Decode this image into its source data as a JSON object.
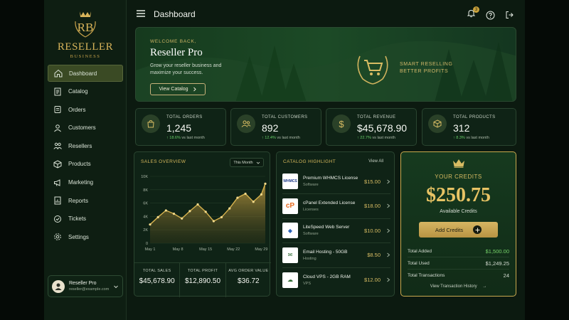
{
  "brand": {
    "initials": "RB",
    "name": "RESELLER",
    "sub": "BUSINESS"
  },
  "header": {
    "title": "Dashboard",
    "notification_count": "3"
  },
  "sidebar": {
    "items": [
      {
        "label": "Dashboard",
        "icon": "dashboard-icon",
        "active": true
      },
      {
        "label": "Catalog",
        "icon": "catalog-icon"
      },
      {
        "label": "Orders",
        "icon": "orders-icon"
      },
      {
        "label": "Customers",
        "icon": "customers-icon"
      },
      {
        "label": "Resellers",
        "icon": "resellers-icon"
      },
      {
        "label": "Products",
        "icon": "products-icon"
      },
      {
        "label": "Marketing",
        "icon": "marketing-icon"
      },
      {
        "label": "Reports",
        "icon": "reports-icon"
      },
      {
        "label": "Tickets",
        "icon": "tickets-icon"
      },
      {
        "label": "Settings",
        "icon": "settings-icon"
      }
    ],
    "user": {
      "name": "Reseller Pro",
      "email": "reseller@example.com"
    }
  },
  "hero": {
    "welcome": "WELCOME BACK,",
    "name": "Reseller Pro",
    "desc": "Grow your reseller business and maximize your success.",
    "cta": "View Catalog",
    "tagline1": "SMART RESELLING",
    "tagline2": "BETTER PROFITS"
  },
  "stats": [
    {
      "label": "TOTAL ORDERS",
      "value": "1,245",
      "trend": "18.6%",
      "trend_text": "vs last month",
      "icon": "bag-icon"
    },
    {
      "label": "TOTAL CUSTOMERS",
      "value": "892",
      "trend": "12.4%",
      "trend_text": "vs last month",
      "icon": "users-icon"
    },
    {
      "label": "TOTAL REVENUE",
      "value": "$45,678.90",
      "trend": "22.7%",
      "trend_text": "vs last month",
      "icon": "dollar-icon"
    },
    {
      "label": "TOTAL PRODUCTS",
      "value": "312",
      "trend": "8.3%",
      "trend_text": "vs last month",
      "icon": "box-icon"
    }
  ],
  "sales": {
    "title": "SALES OVERVIEW",
    "period": "This Month",
    "summary": [
      {
        "label": "TOTAL SALES",
        "value": "$45,678.90"
      },
      {
        "label": "TOTAL PROFIT",
        "value": "$12,890.50"
      },
      {
        "label": "AVG ORDER VALUE",
        "value": "$36.72"
      }
    ]
  },
  "chart_data": {
    "type": "area",
    "x": [
      1,
      3,
      5,
      7,
      9,
      11,
      13,
      15,
      17,
      19,
      21,
      23,
      25,
      27,
      29,
      30
    ],
    "values": [
      2800,
      3900,
      4900,
      4400,
      3700,
      4800,
      5800,
      4700,
      3300,
      3900,
      5200,
      6800,
      7400,
      6200,
      7300,
      8900
    ],
    "xticks": [
      "May 1",
      "May 8",
      "May 15",
      "May 22",
      "May 29"
    ],
    "xtick_positions": [
      1,
      8,
      15,
      22,
      29
    ],
    "yticks": [
      "0",
      "2K",
      "4K",
      "6K",
      "8K",
      "10K"
    ],
    "ylim": [
      0,
      10000
    ],
    "xlim": [
      1,
      30
    ],
    "grid": true,
    "color": "#d6b24e"
  },
  "catalog": {
    "title": "CATALOG HIGHLIGHT",
    "view_all": "View All",
    "items": [
      {
        "name": "Premium WHMCS License",
        "category": "Software",
        "price": "$15.00",
        "logo": "WHMCS",
        "icon": "whmcs-icon"
      },
      {
        "name": "cPanel Extended License",
        "category": "Licenses",
        "price": "$18.00",
        "logo": "cP",
        "icon": "cpanel-icon"
      },
      {
        "name": "LiteSpeed Web Server",
        "category": "Software",
        "price": "$10.00",
        "logo": "",
        "icon": "litespeed-icon"
      },
      {
        "name": "Email Hosting - 50GB",
        "category": "Hosting",
        "price": "$8.50",
        "logo": "",
        "icon": "email-icon"
      },
      {
        "name": "Cloud VPS - 2GB RAM",
        "category": "VPS",
        "price": "$12.00",
        "logo": "",
        "icon": "cloud-icon"
      }
    ]
  },
  "credits": {
    "title": "YOUR CREDITS",
    "amount": "$250.75",
    "available": "Available Credits",
    "add_label": "Add Credits",
    "rows": [
      {
        "label": "Total Added",
        "value": "$1,500.00"
      },
      {
        "label": "Total Used",
        "value": "$1,249.25"
      },
      {
        "label": "Total Transactions",
        "value": "24"
      }
    ],
    "history": "View Transaction History"
  },
  "colors": {
    "accent": "#d6b24e",
    "positive": "#6ad16a",
    "bg": "#0c1a10"
  }
}
